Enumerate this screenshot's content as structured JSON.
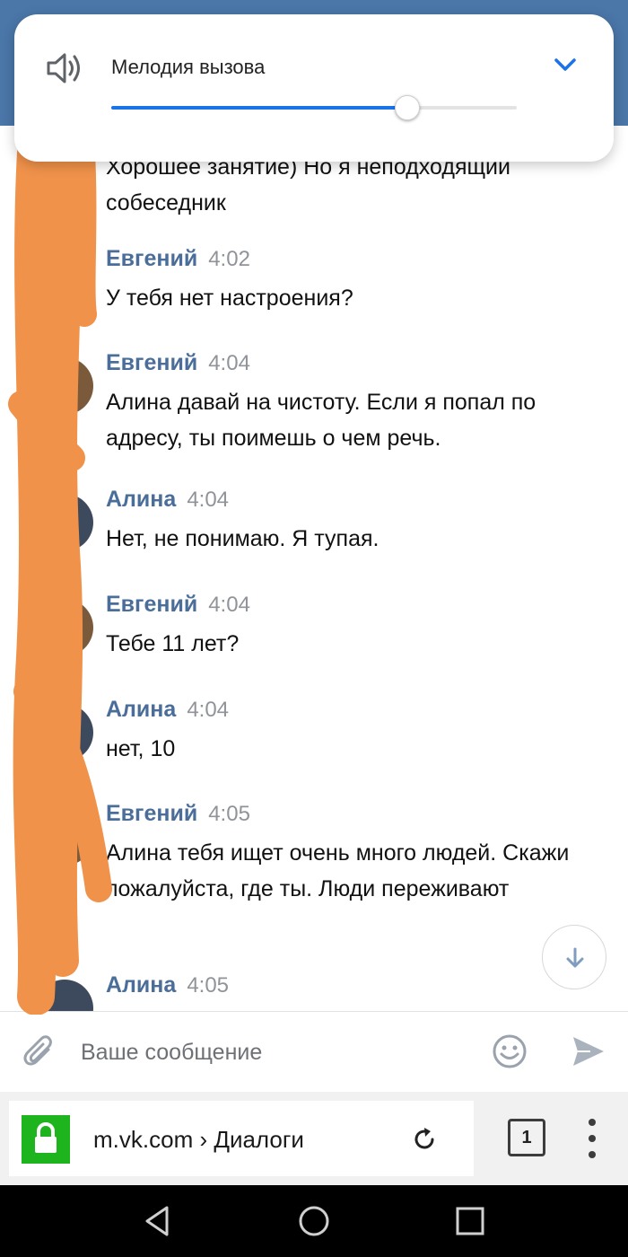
{
  "volume": {
    "label": "Мелодия вызова",
    "level": 0.73,
    "accent_color": "#1a73e8"
  },
  "messages": [
    {
      "author": "",
      "time": "",
      "text": "Хорошее занятие) Но я неподходящий собеседник"
    },
    {
      "author": "Евгений",
      "time": "4:02",
      "text": "У тебя нет настроения?"
    },
    {
      "author": "Евгений",
      "time": "4:04",
      "text": "Алина давай на чистоту. Если я попал по адресу, ты поимешь о чем речь."
    },
    {
      "author": "Алина",
      "time": "4:04",
      "text": "Нет, не понимаю. Я тупая."
    },
    {
      "author": "Евгений",
      "time": "4:04",
      "text": "Тебе 11 лет?"
    },
    {
      "author": "Алина",
      "time": "4:04",
      "text": "нет, 10"
    },
    {
      "author": "Евгений",
      "time": "4:05",
      "text": "Алина тебя ищет очень много людей. Скажи пожалуйста, где ты. Люди переживают"
    },
    {
      "author": "Алина",
      "time": "4:05",
      "text": ""
    }
  ],
  "composer": {
    "placeholder": "Ваше сообщение"
  },
  "browser": {
    "url": "m.vk.com › Диалоги",
    "tab_count": "1"
  },
  "colors": {
    "author": "#4a6e99",
    "time": "#909499",
    "vk_blue": "#4a76a8",
    "lock_green": "#1db41d",
    "redaction": "#f0924a"
  }
}
